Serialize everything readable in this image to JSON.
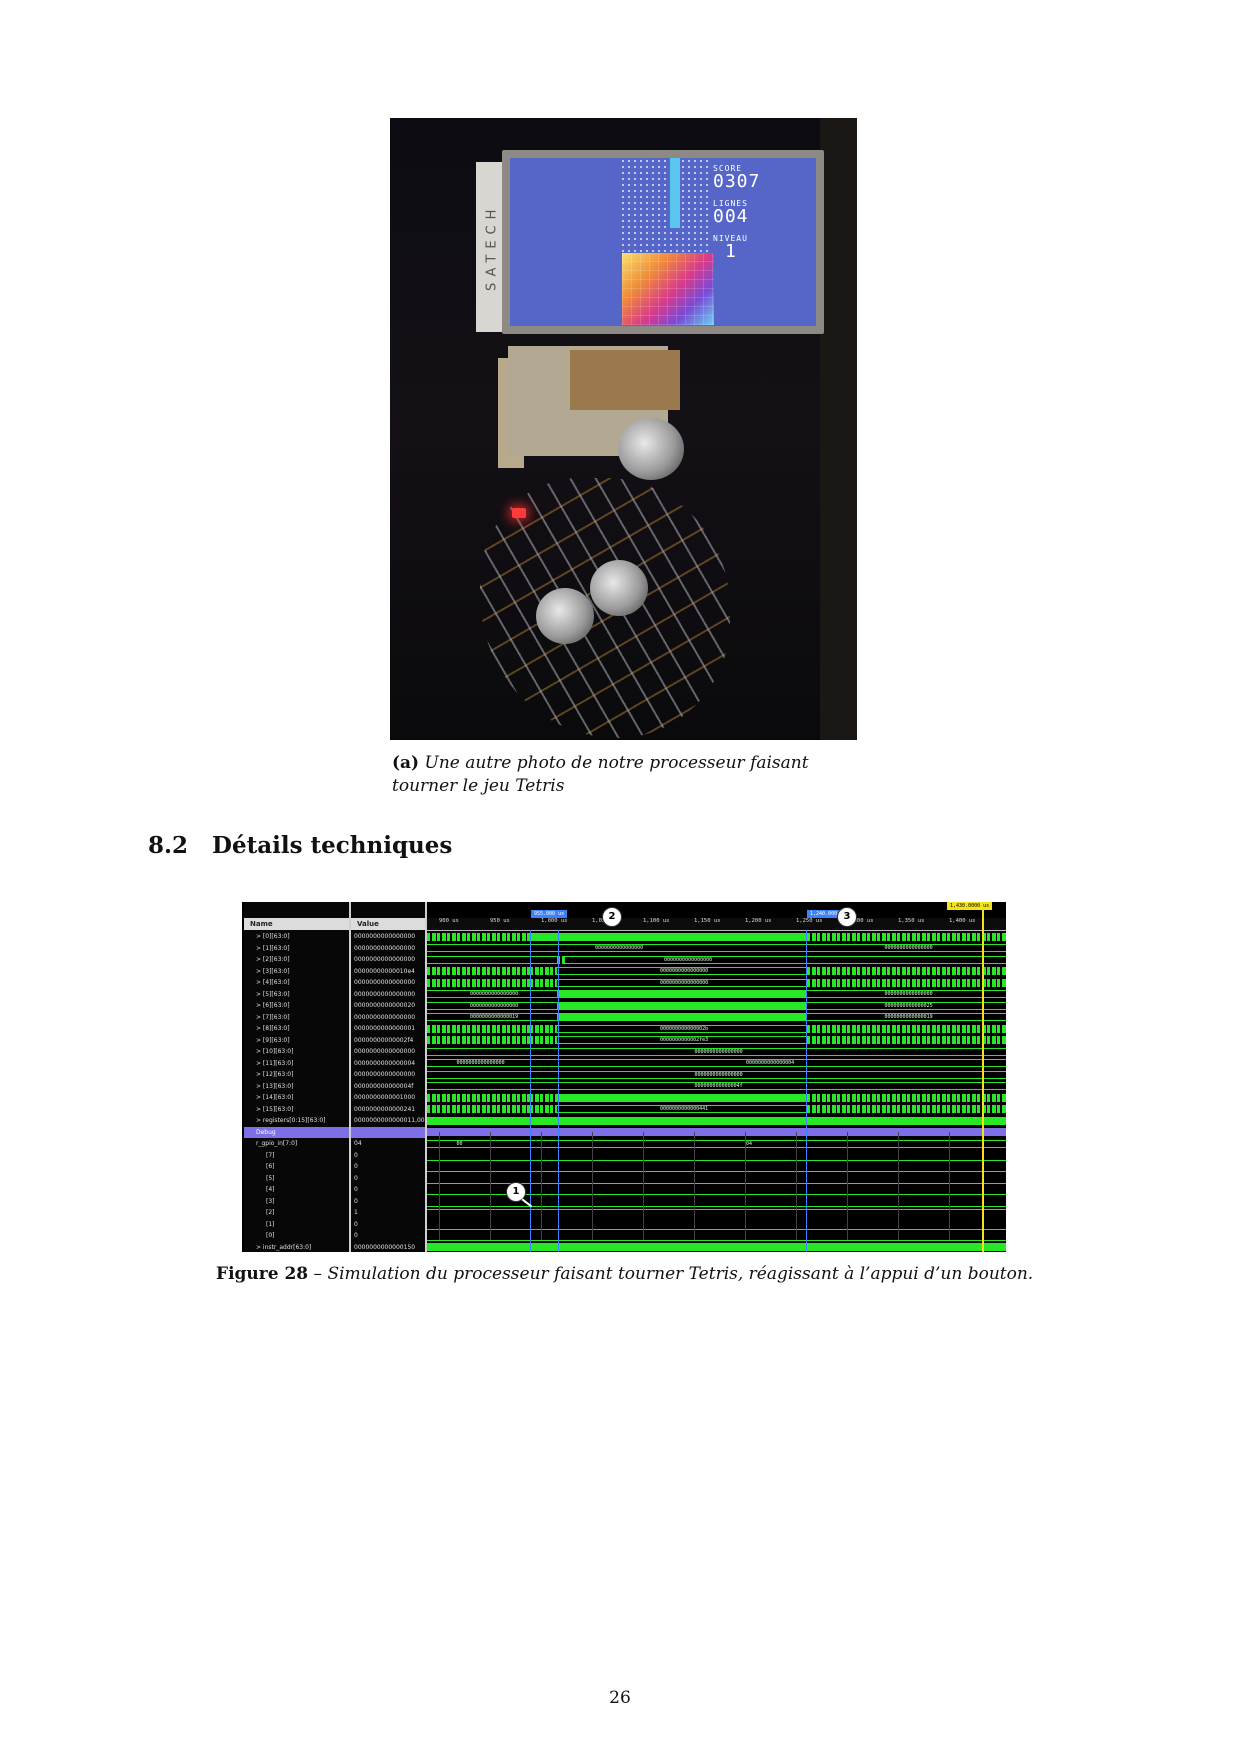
{
  "figure_a": {
    "photo_label": "Une autre photo de notre processeur faisant tourner le jeu Tetris",
    "device_brand_text": "SATECH",
    "game_hud": {
      "score_label": "SCORE",
      "score_value": "0307",
      "lines_label": "LIGNES",
      "lines_value": "004",
      "level_label": "NIVEAU",
      "level_value": "1"
    },
    "caption_label": "(a)",
    "caption_text": "Une autre photo de notre processeur faisant tourner le jeu Tetris"
  },
  "section": {
    "number": "8.2",
    "title": "Détails techniques"
  },
  "simulation": {
    "column_headers": {
      "name": "Name",
      "value": "Value"
    },
    "time_ticks": [
      "900 us",
      "950 us",
      "1,000 us",
      "1,050 us",
      "1,100 us",
      "1,150 us",
      "1,200 us",
      "1,250 us",
      "1,300 us",
      "1,350 us",
      "1,400 us"
    ],
    "marker_flags": [
      "955.000 us",
      "1,240.000 us"
    ],
    "cursor_flag": "1,430.0000 us",
    "markers": [
      "1",
      "2",
      "3"
    ],
    "rows": [
      {
        "name": "> [0][63:0]",
        "value": "0000000000000000"
      },
      {
        "name": "> [1][63:0]",
        "value": "0000000000000000"
      },
      {
        "name": "> [2][63:0]",
        "value": "0000000000000000"
      },
      {
        "name": "> [3][63:0]",
        "value": "00000000000010e4"
      },
      {
        "name": "> [4][63:0]",
        "value": "0000000000000000"
      },
      {
        "name": "> [5][63:0]",
        "value": "0000000000000000"
      },
      {
        "name": "> [6][63:0]",
        "value": "0000000000000020"
      },
      {
        "name": "> [7][63:0]",
        "value": "0000000000000000"
      },
      {
        "name": "> [8][63:0]",
        "value": "0000000000000001"
      },
      {
        "name": "> [9][63:0]",
        "value": "00000000000002f4"
      },
      {
        "name": "> [10][63:0]",
        "value": "0000000000000000"
      },
      {
        "name": "> [11][63:0]",
        "value": "0000000000000004"
      },
      {
        "name": "> [12][63:0]",
        "value": "0000000000000000"
      },
      {
        "name": "> [13][63:0]",
        "value": "000000000000004f"
      },
      {
        "name": "> [14][63:0]",
        "value": "0000000000001000"
      },
      {
        "name": "> [15][63:0]",
        "value": "0000000000000241"
      },
      {
        "name": "> registers[0:15][63:0]",
        "value": "0000000000000011,000"
      },
      {
        "name": "Debug",
        "value": ""
      },
      {
        "name": "r_gpio_in[7:0]",
        "value": "04"
      },
      {
        "name": "[7]",
        "value": "0"
      },
      {
        "name": "[6]",
        "value": "0"
      },
      {
        "name": "[5]",
        "value": "0"
      },
      {
        "name": "[4]",
        "value": "0"
      },
      {
        "name": "[3]",
        "value": "0"
      },
      {
        "name": "[2]",
        "value": "1"
      },
      {
        "name": "[1]",
        "value": "0"
      },
      {
        "name": "[0]",
        "value": "0"
      },
      {
        "name": "> instr_addr[63:0]",
        "value": "0000000000000150"
      }
    ],
    "bus_labels": {
      "r1": "0000000000000000",
      "r1b": "0000000000000000",
      "r2": "0000000000000000",
      "r3": "0000000000000000",
      "r6": "0000000000000000",
      "r6b": "0000000000000000",
      "r7": "0000000000000000",
      "r7b": "0000000000000025",
      "r8": "0000000000000019",
      "r8b": "0000000000000019",
      "r9": "000000000000002b",
      "r10": "0000000000002fe3",
      "r11": "0000000000000000",
      "r12": "0000000000000000",
      "r12b": "0000000000000004",
      "r13": "0000000000000000",
      "r14": "000000000000004f",
      "r16": "0000000000000441",
      "gpio_a": "00",
      "gpio_b": "04"
    }
  },
  "figure_28": {
    "label": "Figure 28",
    "dash": "–",
    "text": "Simulation du processeur faisant tourner Tetris, réagissant à l’appui d’un bouton."
  },
  "page_number": "26",
  "colors": {
    "wave_green": "#27e827",
    "marker_blue": "#3c82ff",
    "cursor_yellow": "#f2e31a",
    "debug_highlight": "#7d70e6",
    "tetris_screen": "#5566c8"
  }
}
